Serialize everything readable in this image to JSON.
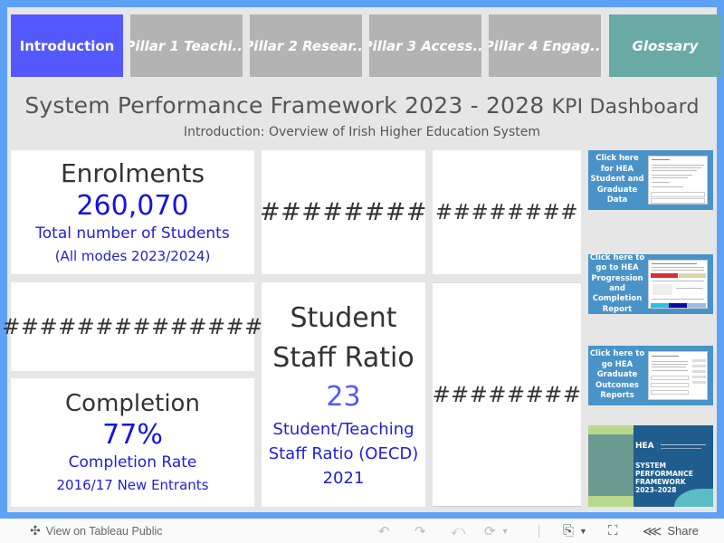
{
  "nav": {
    "tabs": [
      {
        "label": "Introduction",
        "state": "active"
      },
      {
        "label": "Pillar 1 Teachi...",
        "state": "inactive"
      },
      {
        "label": "Pillar 2 Resear...",
        "state": "inactive"
      },
      {
        "label": "Pillar 3 Access...",
        "state": "inactive"
      },
      {
        "label": "Pillar 4 Engag...",
        "state": "inactive"
      },
      {
        "label": "Glossary",
        "state": "glossary"
      }
    ]
  },
  "header": {
    "title_main": "System Performance Framework 2023 - 2028",
    "title_suffix": "KPI Dashboard",
    "subtitle": "Introduction: Overview of Irish Higher Education System"
  },
  "kpis": {
    "enrolments": {
      "title": "Enrolments",
      "value": "260,070",
      "desc": "Total number of Students",
      "sub": "(All modes 2023/2024)"
    },
    "overflow_1": "########",
    "overflow_2": "########",
    "overflow_3": "##############",
    "overflow_4": "########",
    "completion": {
      "title": "Completion",
      "value": "77%",
      "desc": "Completion Rate",
      "sub": "2016/17 New Entrants"
    },
    "ratio": {
      "title_line1": "Student",
      "title_line2": "Staff Ratio",
      "value": "23",
      "desc_line1": "Student/Teaching",
      "desc_line2": "Staff Ratio (OECD)",
      "desc_line3": "2021"
    }
  },
  "links": [
    {
      "text": "Click here for HEA Student and Graduate Data"
    },
    {
      "text": "Click here to go to HEA Progression and Completion Report"
    },
    {
      "text": "Click here to go HEA Graduate Outcomes Reports"
    }
  ],
  "framework_tile": {
    "logo": "HEA",
    "title": "SYSTEM PERFORMANCE FRAMEWORK 2023–2028"
  },
  "colors": {
    "active_tab": "#5459ff",
    "inactive_tab": "#b3b3b3",
    "glossary_tab": "#6aaaa4",
    "kpi_blue": "#1212e8",
    "frame_blue": "#5ea2f7",
    "link_tile": "#4a93c9"
  },
  "toolbar": {
    "view_on_label": "View on Tableau Public",
    "share_label": "Share"
  }
}
